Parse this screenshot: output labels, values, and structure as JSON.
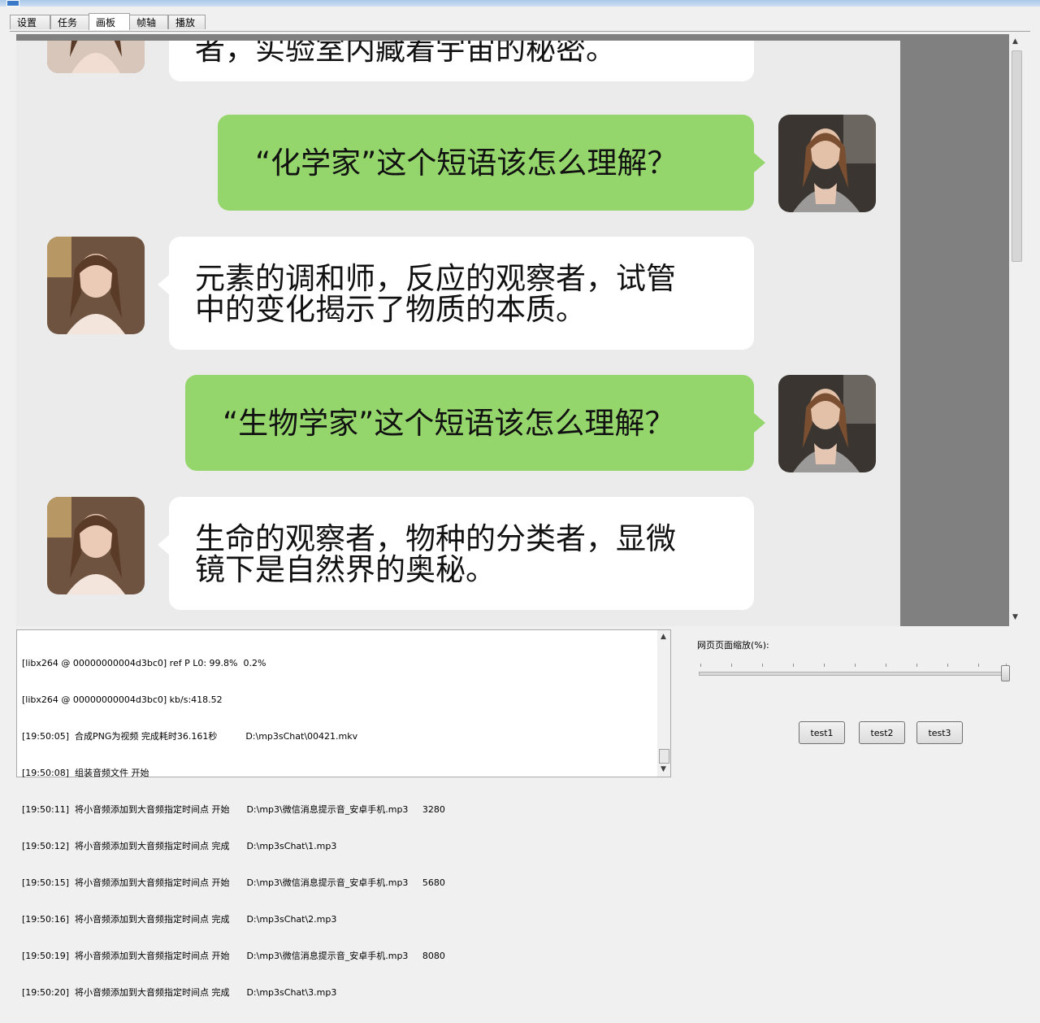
{
  "tabs": [
    {
      "label": "设置"
    },
    {
      "label": "任务"
    },
    {
      "label": "画板"
    },
    {
      "label": "帧轴"
    },
    {
      "label": "播放"
    }
  ],
  "chat": {
    "messages": [
      {
        "side": "left",
        "text": "者，实验室内藏着宇宙的秘密。"
      },
      {
        "side": "right",
        "text": "“化学家”这个短语该怎么理解？"
      },
      {
        "side": "left",
        "lines": [
          "元素的调和师，反应的观察者，试管",
          "中的变化揭示了物质的本质。"
        ]
      },
      {
        "side": "right",
        "text": "“生物学家”这个短语该怎么理解？"
      },
      {
        "side": "left",
        "lines": [
          "生命的观察者，物种的分类者，显微",
          "镜下是自然界的奥秘。"
        ]
      }
    ]
  },
  "log": {
    "lines": [
      "[libx264 @ 00000000004d3bc0] ref P L0: 99.8%  0.2%",
      "[libx264 @ 00000000004d3bc0] kb/s:418.52",
      "[19:50:05]  合成PNG为视频 完成耗时36.161秒          D:\\mp3sChat\\00421.mkv",
      "[19:50:08]  组装音频文件 开始",
      "[19:50:11]  将小音频添加到大音频指定时间点 开始      D:\\mp3\\微信消息提示音_安卓手机.mp3     3280",
      "[19:50:12]  将小音频添加到大音频指定时间点 完成      D:\\mp3sChat\\1.mp3",
      "[19:50:15]  将小音频添加到大音频指定时间点 开始      D:\\mp3\\微信消息提示音_安卓手机.mp3     5680",
      "[19:50:16]  将小音频添加到大音频指定时间点 完成      D:\\mp3sChat\\2.mp3",
      "[19:50:19]  将小音频添加到大音频指定时间点 开始      D:\\mp3\\微信消息提示音_安卓手机.mp3     8080",
      "[19:50:20]  将小音频添加到大音频指定时间点 完成      D:\\mp3sChat\\3.mp3"
    ]
  },
  "zoom": {
    "label": "网页页面缩放(%):",
    "value_percent": 100
  },
  "buttons": {
    "test1": "test1",
    "test2": "test2",
    "test3": "test3"
  },
  "colors": {
    "green_bubble": "#95d66c",
    "white_bubble": "#ffffff",
    "chat_bg": "#ebebeb",
    "viewport_bg": "#808080"
  },
  "icons": {
    "avatar": "person-photo-avatar",
    "scroll_up": "up-arrow-icon",
    "scroll_down": "down-arrow-icon"
  }
}
